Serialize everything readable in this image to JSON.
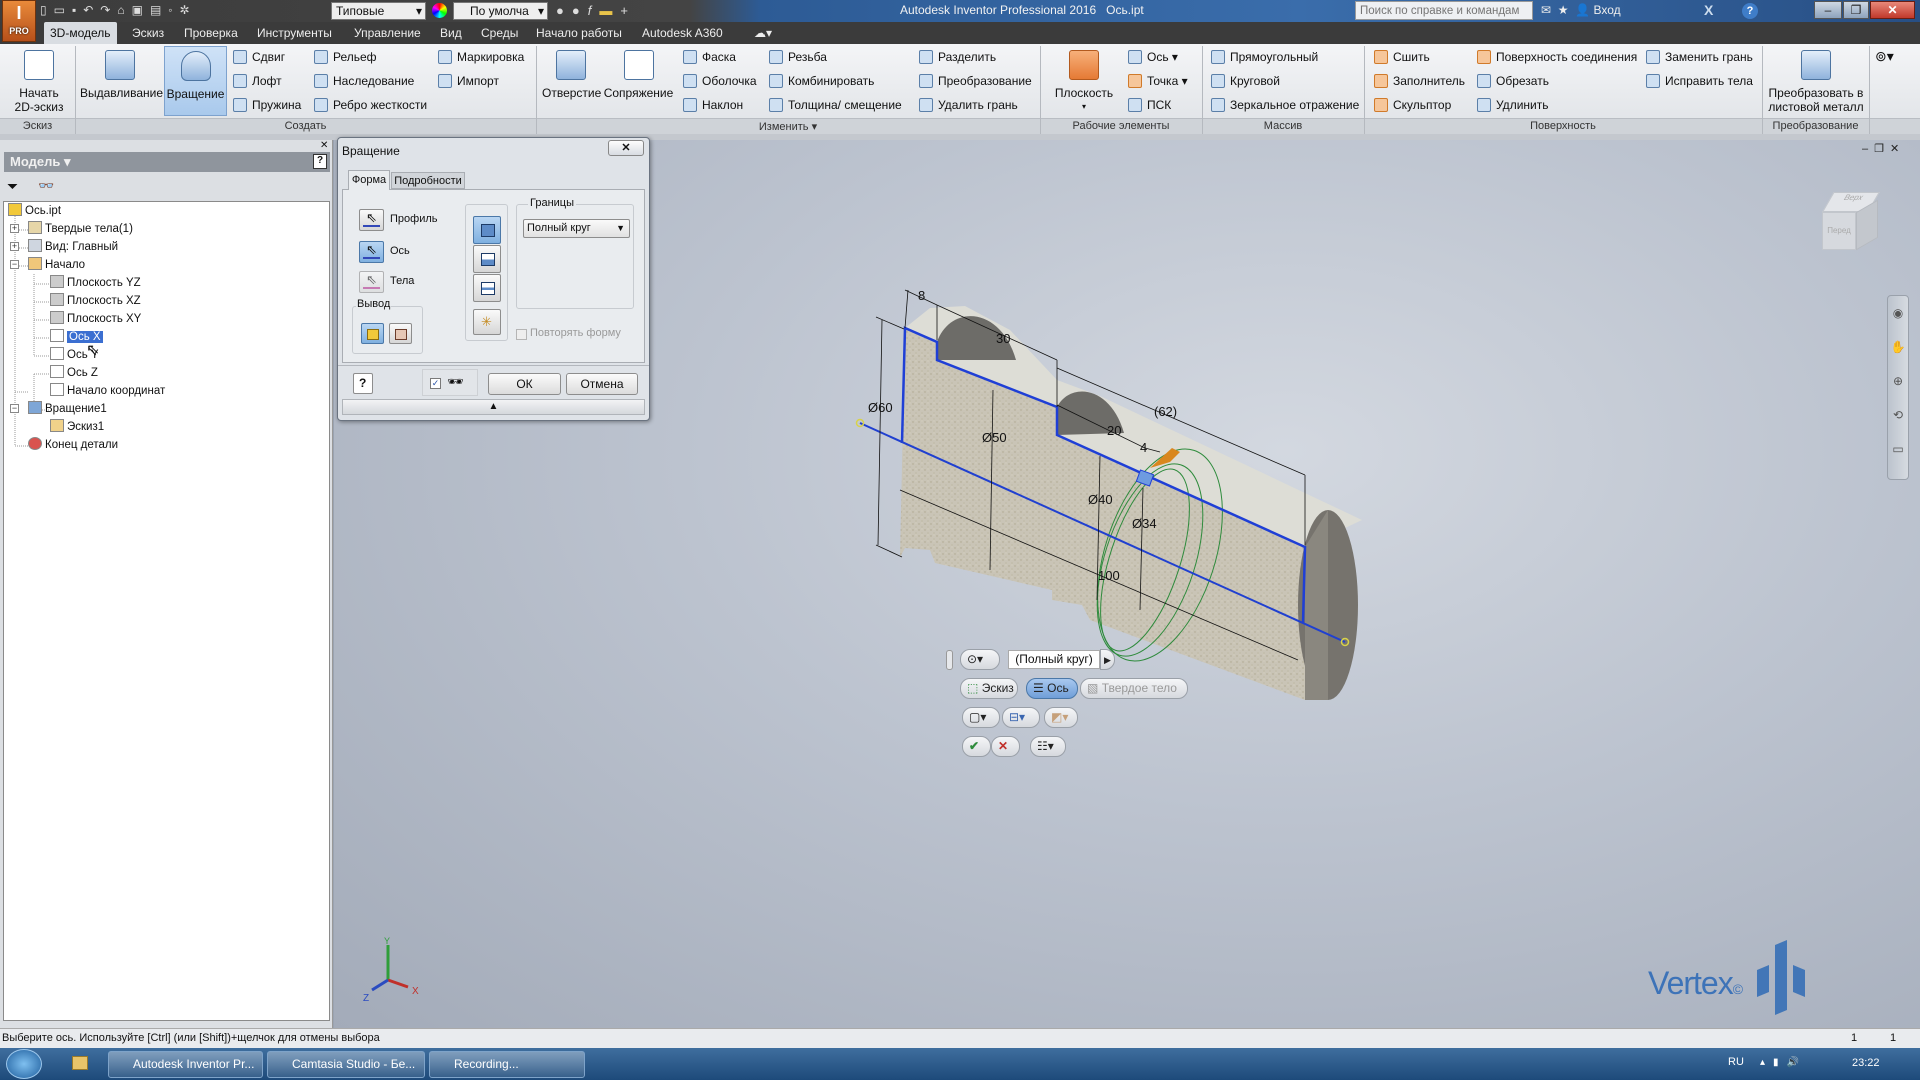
{
  "app": {
    "title": "Autodesk Inventor Professional 2016",
    "document": "Ось.ipt",
    "logo_label": "PRO"
  },
  "quick_access": {
    "appearance_select": "Типовые",
    "material_select": "По умолча"
  },
  "search": {
    "placeholder": "Поиск по справке и командам"
  },
  "account": {
    "signin": "Вход"
  },
  "tabs": [
    {
      "label": "3D-модель",
      "active": true
    },
    {
      "label": "Эскиз"
    },
    {
      "label": "Проверка"
    },
    {
      "label": "Инструменты"
    },
    {
      "label": "Управление"
    },
    {
      "label": "Вид"
    },
    {
      "label": "Среды"
    },
    {
      "label": "Начало работы"
    },
    {
      "label": "Autodesk A360"
    }
  ],
  "ribbon": {
    "panels": {
      "sketch": "Эскиз",
      "create": "Создать",
      "modify": "Изменить ▾",
      "work": "Рабочие элементы",
      "pattern": "Массив",
      "surface": "Поверхность",
      "convert": "Преобразование"
    },
    "start_sketch": "Начать 2D-эскиз",
    "extrude": "Выдавливание",
    "revolve": "Вращение",
    "sweep": "Сдвиг",
    "loft": "Лофт",
    "coil": "Пружина",
    "emboss": "Рельеф",
    "derive": "Наследование",
    "rib": "Ребро жесткости",
    "mark": "Маркировка",
    "import": "Импорт",
    "hole": "Отверстие",
    "fillet": "Сопряжение",
    "chamfer": "Фаска",
    "shell": "Оболочка",
    "draft": "Наклон",
    "thread": "Резьба",
    "combine": "Комбинировать",
    "thicken": "Толщина/ смещение",
    "split": "Разделить",
    "transform": "Преобразование",
    "delete_face": "Удалить грань",
    "plane": "Плоскость",
    "axis": "Ось",
    "point": "Точка",
    "ucs": "ПСК",
    "rectangular": "Прямоугольный",
    "circular": "Круговой",
    "mirror": "Зеркальное отражение",
    "stitch": "Сшить",
    "patch": "Заполнитель",
    "sculpt": "Скульптор",
    "boundary_patch": "Поверхность соединения",
    "trim": "Обрезать",
    "extend": "Удлинить",
    "replace_face": "Заменить грань",
    "repair": "Исправить тела",
    "convert_sheet": "Преобразовать в листовой металл"
  },
  "browser": {
    "title": "Модель ▾",
    "items": [
      {
        "label": "Ось.ipt",
        "level": 0
      },
      {
        "label": "Твердые тела(1)",
        "level": 1,
        "expander": "+"
      },
      {
        "label": "Вид: Главный",
        "level": 1,
        "expander": "+"
      },
      {
        "label": "Начало",
        "level": 1,
        "expander": "−"
      },
      {
        "label": "Плоскость YZ",
        "level": 2
      },
      {
        "label": "Плоскость XZ",
        "level": 2
      },
      {
        "label": "Плоскость XY",
        "level": 2
      },
      {
        "label": "Ось X",
        "level": 2,
        "selected": true
      },
      {
        "label": "Ось Y",
        "level": 2
      },
      {
        "label": "Ось Z",
        "level": 2
      },
      {
        "label": "Начало координат",
        "level": 2
      },
      {
        "label": "Вращение1",
        "level": 1,
        "expander": "−"
      },
      {
        "label": "Эскиз1",
        "level": 2
      },
      {
        "label": "Конец детали",
        "level": 1
      }
    ]
  },
  "dialog": {
    "title": "Вращение",
    "tabs": [
      "Форма",
      "Подробности"
    ],
    "profile": "Профиль",
    "axis": "Ось",
    "solids": "Тела",
    "output": "Вывод",
    "extents": "Границы",
    "extents_value": "Полный круг",
    "match_shape": "Повторять форму",
    "ok": "ОК",
    "cancel": "Отмена"
  },
  "mini_toolbar": {
    "extent": "(Полный круг)",
    "profile": "Эскиз",
    "axis": "Ось",
    "solid": "Твердое тело"
  },
  "dimensions": [
    "8",
    "30",
    "Ø60",
    "Ø50",
    "20",
    "4",
    "(62)",
    "Ø40",
    "Ø34",
    "100"
  ],
  "triad": {
    "x": "X",
    "y": "Y",
    "z": "Z"
  },
  "viewcube": {
    "top": "Верх",
    "front": "Перед"
  },
  "watermark": "Vertex",
  "status": {
    "message": "Выберите ось. Используйте [Ctrl] (или [Shift])+щелчок для отмены выбора",
    "count1": "1",
    "count2": "1"
  },
  "taskbar": {
    "items": [
      "Autodesk Inventor Pr...",
      "Camtasia Studio - Бе...",
      "Recording..."
    ],
    "lang": "RU",
    "time": "23:22"
  },
  "colors": {
    "accent": "#3b6fd1",
    "profile_line": "#1f3fd6",
    "axis_line": "#2040d0"
  }
}
